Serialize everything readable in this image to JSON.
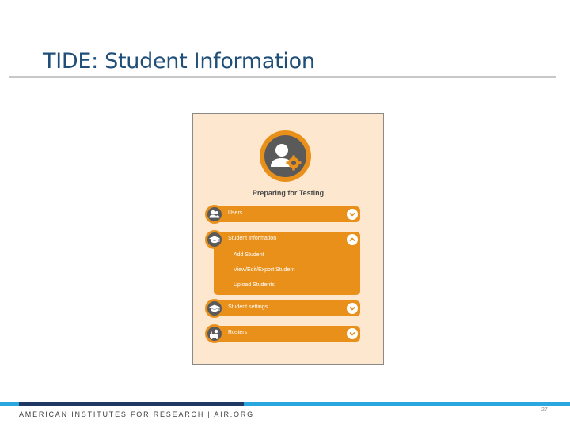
{
  "slide": {
    "title": "TIDE: Student Information",
    "footer": "AMERICAN INSTITUTES FOR RESEARCH | AIR.ORG",
    "page_number": "27"
  },
  "screenshot": {
    "heading": "Preparing for Testing",
    "hero_icon": "user-gear-icon",
    "menu": [
      {
        "label": "Users",
        "icon": "users-icon",
        "expanded": false
      },
      {
        "label": "Student Information",
        "icon": "graduation-cap-icon",
        "expanded": true,
        "subitems": [
          "Add Student",
          "View/Edit/Export Student",
          "Upload Students"
        ]
      },
      {
        "label": "Student settings",
        "icon": "graduation-cap-icon",
        "expanded": false
      },
      {
        "label": "Rosters",
        "icon": "roster-icon",
        "expanded": false
      }
    ]
  },
  "colors": {
    "accent_orange": "#e8901a",
    "panel_background": "#fde8cf",
    "icon_gray": "#5a5a5a",
    "title_blue": "#1f4e79",
    "footer_blue": "#29a8e0",
    "footer_navy": "#1f3864"
  }
}
